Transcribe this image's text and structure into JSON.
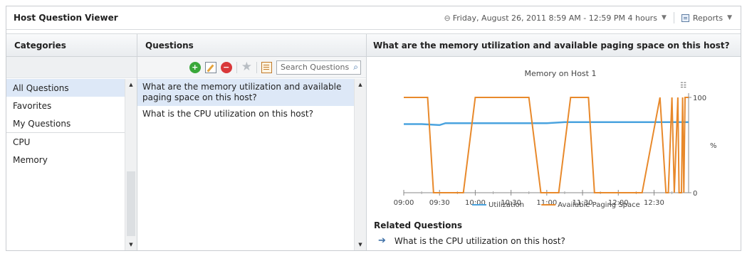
{
  "viewer": {
    "title": "Host Question Viewer"
  },
  "timebar": {
    "range": "Friday, August 26, 2011 8:59 AM - 12:59 PM 4 hours",
    "reports_label": "Reports"
  },
  "categories": {
    "header": "Categories",
    "items": [
      "All Questions",
      "Favorites",
      "My Questions",
      "CPU",
      "Memory"
    ],
    "selected": "All Questions"
  },
  "questions": {
    "header": "Questions",
    "search_placeholder": "Search Questions",
    "items": [
      "What are the memory utilization and available paging space on this host?",
      "What is the CPU utilization on this host?"
    ],
    "selected": 0
  },
  "detail": {
    "header": "What are the memory utilization and available paging space on this host?",
    "related_title": "Related Questions",
    "related_items": [
      "What is the CPU utilization on this host?"
    ]
  },
  "chart_data": {
    "type": "line",
    "title": "Memory on Host 1",
    "ylabel_right": "%",
    "ylim": [
      0,
      100
    ],
    "y_ticks": [
      "0",
      "100"
    ],
    "x_ticks": [
      "09:00",
      "09:30",
      "10:00",
      "10:30",
      "11:00",
      "11:30",
      "12:00",
      "12:30"
    ],
    "xlim": [
      "09:00",
      "12:59"
    ],
    "legend_position": "bottom",
    "series": [
      {
        "name": "Utilization",
        "color": "#4aa3df",
        "x": [
          "09:00",
          "09:15",
          "09:30",
          "09:35",
          "09:45",
          "10:00",
          "10:15",
          "10:30",
          "10:45",
          "11:00",
          "11:15",
          "11:30",
          "11:45",
          "12:00",
          "12:15",
          "12:30",
          "12:45",
          "12:59"
        ],
        "y": [
          72,
          72,
          71,
          73,
          73,
          73,
          73,
          73,
          73,
          73,
          74,
          74,
          74,
          74,
          74,
          74,
          74,
          74
        ]
      },
      {
        "name": "Available Paging Space",
        "color": "#e8892b",
        "x": [
          "09:00",
          "09:20",
          "09:25",
          "09:35",
          "09:50",
          "10:00",
          "10:45",
          "10:55",
          "11:10",
          "11:20",
          "11:35",
          "11:40",
          "11:55",
          "12:15",
          "12:20",
          "12:35",
          "12:40",
          "12:42",
          "12:45",
          "12:47",
          "12:50",
          "12:51",
          "12:53",
          "12:54",
          "12:55",
          "12:56",
          "12:59"
        ],
        "y": [
          100,
          100,
          0,
          0,
          0,
          100,
          100,
          0,
          0,
          100,
          100,
          0,
          0,
          0,
          0,
          100,
          0,
          0,
          100,
          0,
          100,
          0,
          0,
          100,
          0,
          100,
          100
        ]
      }
    ]
  }
}
